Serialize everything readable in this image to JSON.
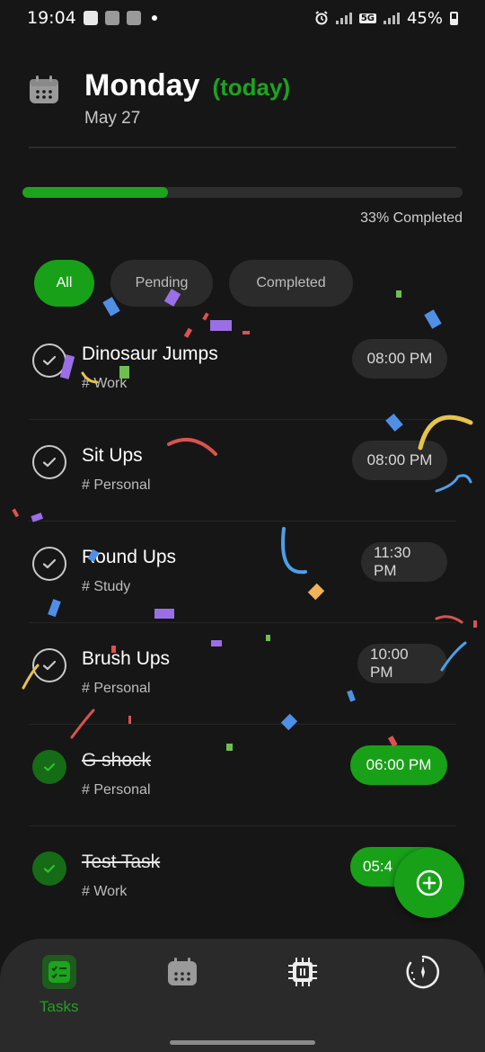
{
  "status_bar": {
    "time": "19:04",
    "battery": "45%",
    "network": "5G"
  },
  "header": {
    "day": "Monday",
    "today_tag": "(today)",
    "date": "May 27"
  },
  "progress": {
    "fraction": 0.33,
    "label": "33% Completed"
  },
  "filters": [
    {
      "label": "All",
      "active": true
    },
    {
      "label": "Pending",
      "active": false
    },
    {
      "label": "Completed",
      "active": false
    }
  ],
  "tasks": [
    {
      "title": "Dinosaur Jumps",
      "tag": "# Work",
      "time": "08:00 PM",
      "done": false
    },
    {
      "title": "Sit Ups",
      "tag": "# Personal",
      "time": "08:00 PM",
      "done": false
    },
    {
      "title": "Round Ups",
      "tag": "# Study",
      "time": "11:30 PM",
      "done": false
    },
    {
      "title": "Brush Ups",
      "tag": "# Personal",
      "time": "10:00 PM",
      "done": false
    },
    {
      "title": "G shock",
      "tag": "# Personal",
      "time": "06:00 PM",
      "done": true
    },
    {
      "title": "Test Task",
      "tag": "# Work",
      "time": "05:4",
      "done": true
    }
  ],
  "bottom_nav": {
    "tasks_label": "Tasks",
    "items": [
      "checklist-icon",
      "calendar-icon",
      "chip-icon",
      "timer-icon"
    ]
  },
  "colors": {
    "accent": "#18a118",
    "background": "#161616",
    "card": "#2b2b2b"
  }
}
